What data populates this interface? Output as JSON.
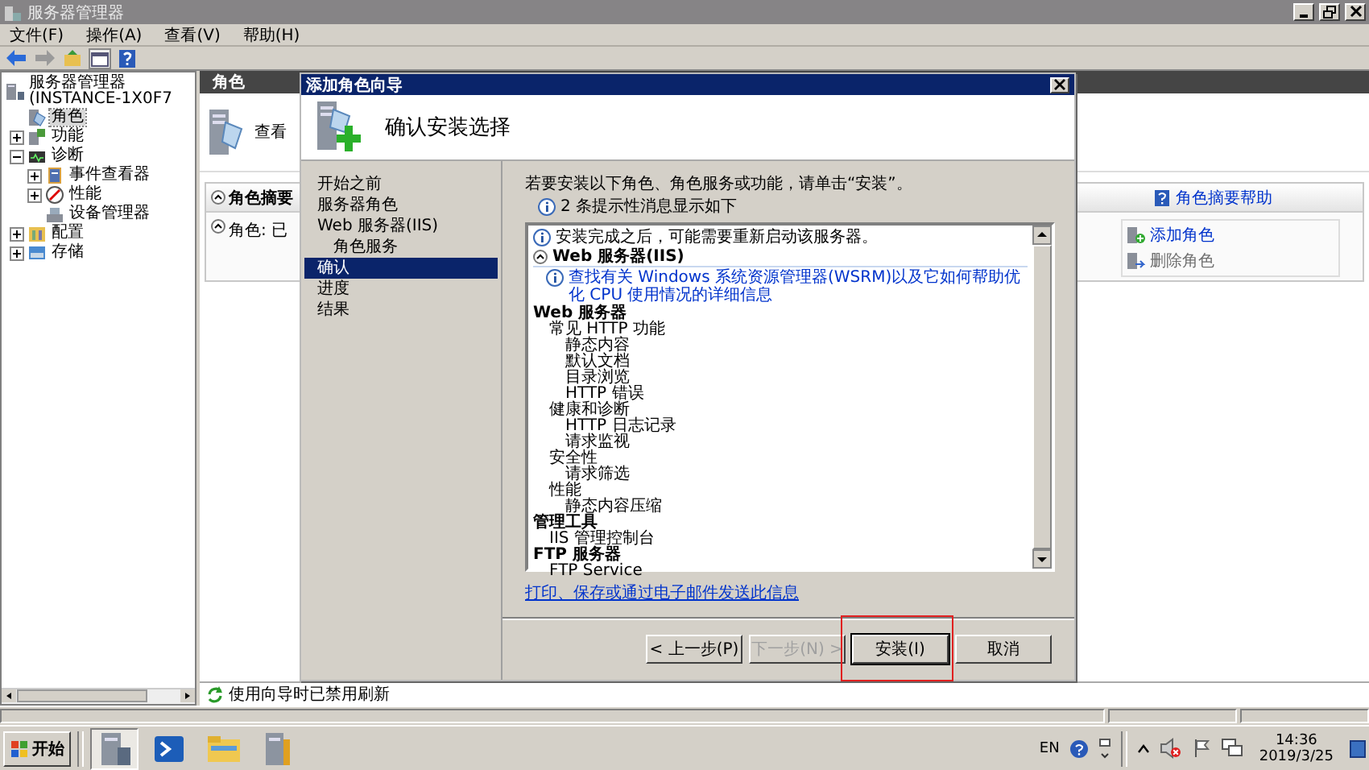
{
  "window": {
    "title": "服务器管理器"
  },
  "menu": [
    "文件(F)",
    "操作(A)",
    "查看(V)",
    "帮助(H)"
  ],
  "tree": {
    "label": "服务器管理器 (INSTANCE-1X0F7",
    "kind": "server",
    "selected": false,
    "children": [
      {
        "label": "角色",
        "kind": "roles",
        "selected": true
      },
      {
        "label": "功能",
        "kind": "features",
        "selected": false,
        "expanded": false
      },
      {
        "label": "诊断",
        "kind": "diagnostics",
        "selected": false,
        "expanded": true,
        "children": [
          {
            "label": "事件查看器",
            "kind": "events",
            "selected": false,
            "expanded": false
          },
          {
            "label": "性能",
            "kind": "performance",
            "selected": false,
            "expanded": false
          },
          {
            "label": "设备管理器",
            "kind": "devices",
            "selected": false
          }
        ]
      },
      {
        "label": "配置",
        "kind": "configuration",
        "selected": false,
        "expanded": false
      },
      {
        "label": "存储",
        "kind": "storage",
        "selected": false,
        "expanded": false
      }
    ]
  },
  "pane": {
    "header": "角色",
    "intro": "查看",
    "section": {
      "title": "角色摘要",
      "help": "角色摘要帮助",
      "roles_label": "角色: 已",
      "actions": [
        {
          "label": "添加角色",
          "disabled": false
        },
        {
          "label": "删除角色",
          "disabled": true
        }
      ]
    },
    "notice": "使用向导时已禁用刷新"
  },
  "wizard": {
    "title": "添加角色向导",
    "heading": "确认安装选择",
    "steps": [
      {
        "label": "开始之前",
        "selected": false
      },
      {
        "label": "服务器角色",
        "selected": false
      },
      {
        "label": "Web 服务器(IIS)",
        "selected": false,
        "children": [
          {
            "label": "角色服务",
            "selected": false
          }
        ]
      },
      {
        "label": "确认",
        "selected": true
      },
      {
        "label": "进度",
        "selected": false
      },
      {
        "label": "结果",
        "selected": false
      }
    ],
    "intro": "若要安装以下角色、角色服务或功能，请单击“安装”。",
    "message_count": "2 条提示性消息显示如下",
    "summary": [
      {
        "kind": "info",
        "text": "安装完成之后，可能需要重新启动该服务器。"
      },
      {
        "kind": "section",
        "text": "Web 服务器(IIS)",
        "expanded": true
      },
      {
        "kind": "link",
        "text": "查找有关 Windows 系统资源管理器(WSRM)以及它如何帮助优化 CPU 使用情况的详细信息"
      },
      {
        "kind": "tree",
        "items": [
          {
            "label": "Web 服务器",
            "children": [
              {
                "label": "常见 HTTP 功能",
                "children": [
                  {
                    "label": "静态内容"
                  },
                  {
                    "label": "默认文档"
                  },
                  {
                    "label": "目录浏览"
                  },
                  {
                    "label": "HTTP 错误"
                  }
                ]
              },
              {
                "label": "健康和诊断",
                "children": [
                  {
                    "label": "HTTP 日志记录"
                  },
                  {
                    "label": "请求监视"
                  }
                ]
              },
              {
                "label": "安全性",
                "children": [
                  {
                    "label": "请求筛选"
                  }
                ]
              },
              {
                "label": "性能",
                "children": [
                  {
                    "label": "静态内容压缩"
                  }
                ]
              }
            ]
          },
          {
            "label": "管理工具",
            "children": [
              {
                "label": "IIS 管理控制台"
              }
            ]
          },
          {
            "label": "FTP 服务器",
            "children": [
              {
                "label": "FTP Service"
              }
            ]
          }
        ]
      }
    ],
    "link": "打印、保存或通过电子邮件发送此信息",
    "buttons": [
      {
        "label": "< 上一步(P)",
        "disabled": false,
        "highlighted": false
      },
      {
        "label": "下一步(N) >",
        "disabled": true,
        "highlighted": false
      },
      {
        "label": "安装(I)",
        "disabled": false,
        "highlighted": true
      },
      {
        "label": "取消",
        "disabled": false,
        "highlighted": false
      }
    ]
  },
  "taskbar": {
    "start": "开始",
    "apps": [
      {
        "kind": "server",
        "selected": true
      },
      {
        "kind": "shell",
        "selected": false
      },
      {
        "kind": "folder",
        "selected": false
      },
      {
        "kind": "tools",
        "selected": false
      }
    ],
    "language": "EN",
    "time": "14:36",
    "date": "2019/3/25"
  }
}
